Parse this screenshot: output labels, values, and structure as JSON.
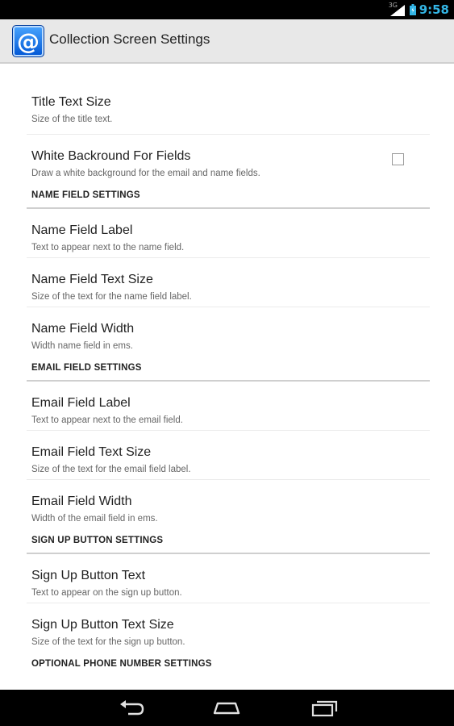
{
  "status_bar": {
    "network_type": "3G",
    "time": "9:58"
  },
  "action_bar": {
    "app_icon_glyph": "@",
    "title": "Collection Screen Settings"
  },
  "preferences": {
    "title_text_size": {
      "title": "Title Text Size",
      "summary": "Size of the title text."
    },
    "white_background": {
      "title": "White Backround For Fields",
      "summary": "Draw a white background for the email and name fields.",
      "checked": false
    },
    "name_section": "NAME FIELD SETTINGS",
    "name_label": {
      "title": "Name Field Label",
      "summary": "Text to appear next to the name field."
    },
    "name_text_size": {
      "title": "Name Field Text Size",
      "summary": "Size of the text for the name field label."
    },
    "name_width": {
      "title": "Name Field Width",
      "summary": "Width name field in ems."
    },
    "email_section": "EMAIL FIELD SETTINGS",
    "email_label": {
      "title": "Email Field Label",
      "summary": "Text to appear next to the email field."
    },
    "email_text_size": {
      "title": "Email Field Text Size",
      "summary": "Size of the text for the email field label."
    },
    "email_width": {
      "title": "Email Field Width",
      "summary": "Width of the email field in ems."
    },
    "signup_section": "SIGN UP BUTTON SETTINGS",
    "signup_text": {
      "title": "Sign Up Button Text",
      "summary": "Text to appear on the sign up button."
    },
    "signup_text_size": {
      "title": "Sign Up Button Text Size",
      "summary": "Size of the text for the sign up button."
    },
    "phone_section": "OPTIONAL PHONE NUMBER SETTINGS"
  },
  "nav_bar": {
    "icons": [
      "back-icon",
      "home-icon",
      "recents-icon"
    ]
  },
  "colors": {
    "status_time": "#33b5e5",
    "action_bar_bg": "#e8e8e8",
    "section_divider": "#cfcfcf"
  }
}
